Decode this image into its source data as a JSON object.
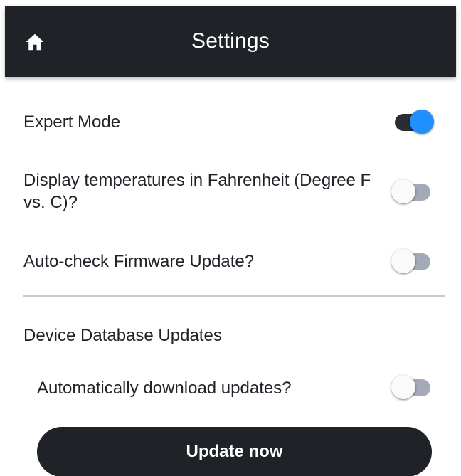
{
  "appbar": {
    "title": "Settings",
    "home_icon": "home-icon"
  },
  "settings": [
    {
      "label": "Expert Mode",
      "enabled": true
    },
    {
      "label": "Display temperatures in Fahrenheit (Degree F vs. C)?",
      "enabled": false
    },
    {
      "label": "Auto-check Firmware Update?",
      "enabled": false
    }
  ],
  "database": {
    "section_title": "Device Database Updates",
    "auto_download": {
      "label": "Automatically download updates?",
      "enabled": false
    },
    "update_button": "Update now"
  },
  "colors": {
    "appbar": "#1f2328",
    "toggle_on_thumb": "#2190ff",
    "toggle_off_track": "#a3a9b6",
    "divider": "#c7c9cc"
  }
}
